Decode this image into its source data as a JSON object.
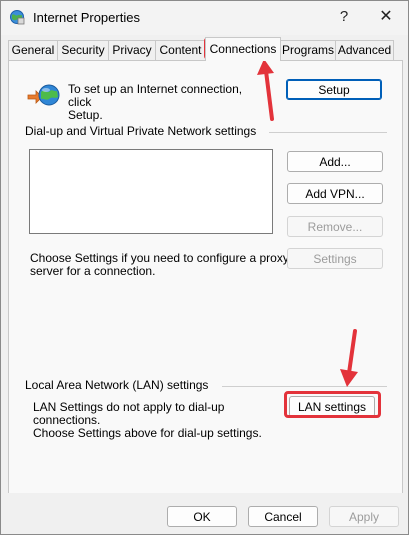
{
  "window": {
    "title": "Internet Properties",
    "help_glyph": "?",
    "close_glyph": "✕"
  },
  "tabs": [
    {
      "label": "General"
    },
    {
      "label": "Security"
    },
    {
      "label": "Privacy"
    },
    {
      "label": "Content"
    },
    {
      "label": "Connections",
      "selected": true
    },
    {
      "label": "Programs"
    },
    {
      "label": "Advanced"
    }
  ],
  "setup": {
    "text_line1": "To set up an Internet connection, click",
    "text_line2": "Setup.",
    "button": "Setup"
  },
  "dialup": {
    "heading": "Dial-up and Virtual Private Network settings",
    "add_button": "Add...",
    "add_vpn_button": "Add VPN...",
    "remove_button": "Remove...",
    "settings_button": "Settings",
    "proxy_line1": "Choose Settings if you need to configure a proxy",
    "proxy_line2": "server for a connection."
  },
  "lan": {
    "heading": "Local Area Network (LAN) settings",
    "line1": "LAN Settings do not apply to dial-up connections.",
    "line2": "Choose Settings above for dial-up settings.",
    "button": "LAN settings"
  },
  "footer": {
    "ok": "OK",
    "cancel": "Cancel",
    "apply": "Apply"
  },
  "colors": {
    "highlight": "#e3333b",
    "accent": "#005fb8"
  },
  "icons": [
    "internet-properties-icon",
    "globe-network-icon",
    "red-arrow-icon"
  ]
}
